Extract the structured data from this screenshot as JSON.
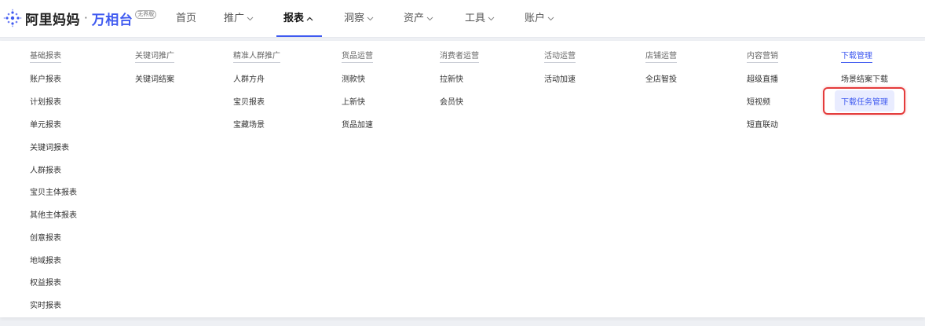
{
  "brand": {
    "main": "阿里妈妈",
    "separator": "·",
    "sub": "万相台",
    "badge": "无界版"
  },
  "nav": [
    {
      "label": "首页",
      "has_chevron": false
    },
    {
      "label": "推广",
      "has_chevron": true
    },
    {
      "label": "报表",
      "has_chevron": true,
      "active": true
    },
    {
      "label": "洞察",
      "has_chevron": true
    },
    {
      "label": "资产",
      "has_chevron": true
    },
    {
      "label": "工具",
      "has_chevron": true
    },
    {
      "label": "账户",
      "has_chevron": true
    }
  ],
  "menu": {
    "columns": [
      {
        "title": "基础报表",
        "items": [
          "账户报表",
          "计划报表",
          "单元报表",
          "关键词报表",
          "人群报表",
          "宝贝主体报表",
          "其他主体报表",
          "创意报表",
          "地域报表",
          "权益报表",
          "实时报表"
        ]
      },
      {
        "title": "关键词推广",
        "items": [
          "关键词结案"
        ]
      },
      {
        "title": "精准人群推广",
        "items": [
          "人群方舟",
          "宝贝报表",
          "宝藏场景"
        ]
      },
      {
        "title": "货品运营",
        "items": [
          "测款快",
          "上新快",
          "货品加速"
        ]
      },
      {
        "title": "消费者运营",
        "items": [
          "拉新快",
          "会员快"
        ]
      },
      {
        "title": "活动运营",
        "items": [
          "活动加速"
        ]
      },
      {
        "title": "店铺运营",
        "items": [
          "全店智投"
        ]
      },
      {
        "title": "内容营销",
        "items": [
          "超级直播",
          "短视频",
          "短直联动"
        ]
      },
      {
        "title": "下载管理",
        "items": [
          "场景结案下载",
          "下载任务管理"
        ],
        "active": true,
        "highlighted_item": "下载任务管理"
      }
    ]
  },
  "colors": {
    "accent": "#3f5af0",
    "highlight_bg": "#e9ecff",
    "annotation_red": "#e43b3b"
  }
}
